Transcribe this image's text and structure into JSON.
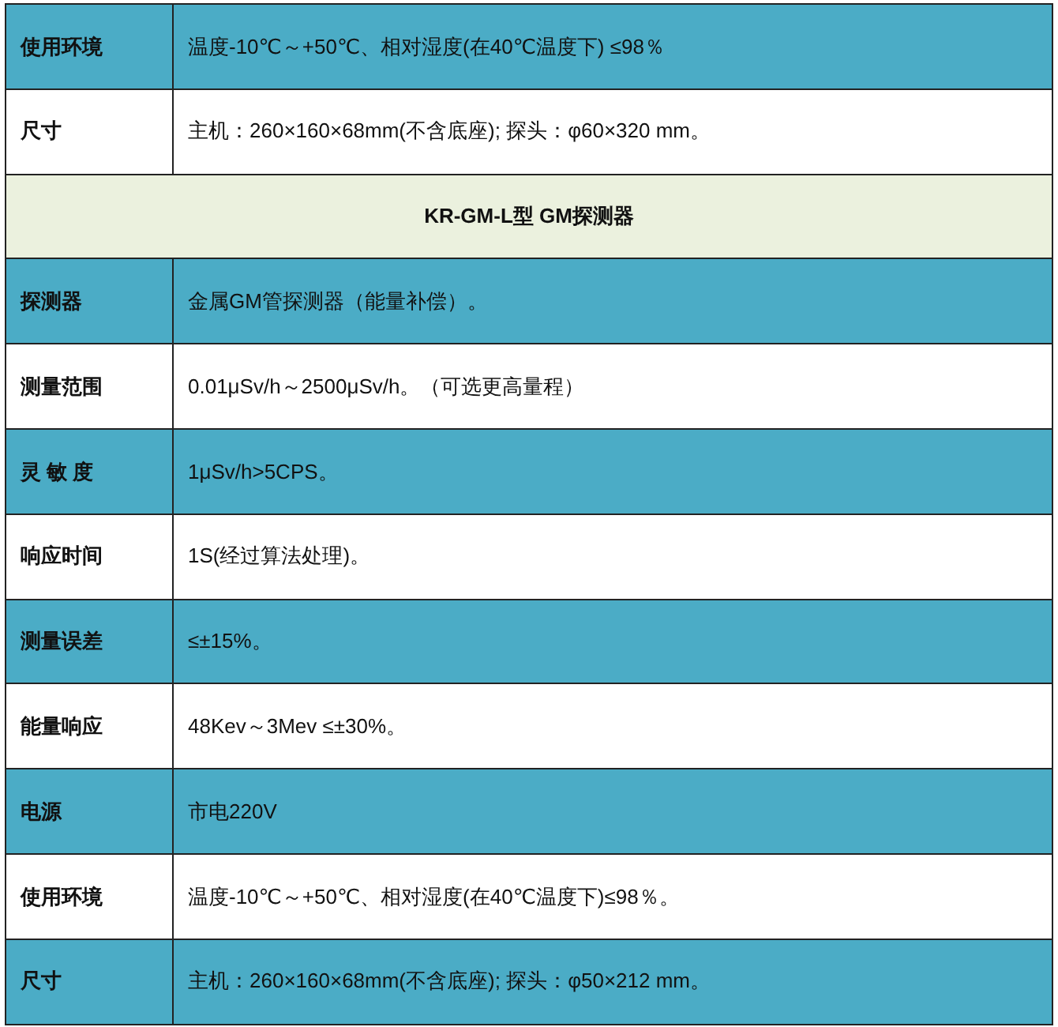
{
  "rows": [
    {
      "kind": "spec",
      "highlighted": true,
      "label": "使用环境",
      "value": "温度-10℃～+50℃、相对湿度(在40℃温度下) ≤98％"
    },
    {
      "kind": "spec",
      "highlighted": false,
      "label": "尺寸",
      "value": "主机：260×160×68mm(不含底座); 探头：φ60×320 mm。"
    },
    {
      "kind": "section",
      "title": "KR-GM-L型  GM探测器"
    },
    {
      "kind": "spec",
      "highlighted": true,
      "label": "探测器",
      "value": "金属GM管探测器（能量补偿）。"
    },
    {
      "kind": "spec",
      "highlighted": false,
      "label": "测量范围",
      "value": "0.01μSv/h～2500μSv/h。（可选更高量程）"
    },
    {
      "kind": "spec",
      "highlighted": true,
      "label": "灵 敏 度",
      "value": "1μSv/h>5CPS。"
    },
    {
      "kind": "spec",
      "highlighted": false,
      "label": "响应时间",
      "value": "1S(经过算法处理)。"
    },
    {
      "kind": "spec",
      "highlighted": true,
      "label": "测量误差",
      "value": "≤±15%。"
    },
    {
      "kind": "spec",
      "highlighted": false,
      "label": "能量响应",
      "value": "48Kev～3Mev ≤±30%。"
    },
    {
      "kind": "spec",
      "highlighted": true,
      "label": "电源",
      "value": "市电220V"
    },
    {
      "kind": "spec",
      "highlighted": false,
      "label": "使用环境",
      "value": "温度-10℃～+50℃、相对湿度(在40℃温度下)≤98％。"
    },
    {
      "kind": "spec",
      "highlighted": true,
      "label": "尺寸",
      "value": "主机：260×160×68mm(不含底座); 探头：φ50×212 mm。"
    }
  ]
}
